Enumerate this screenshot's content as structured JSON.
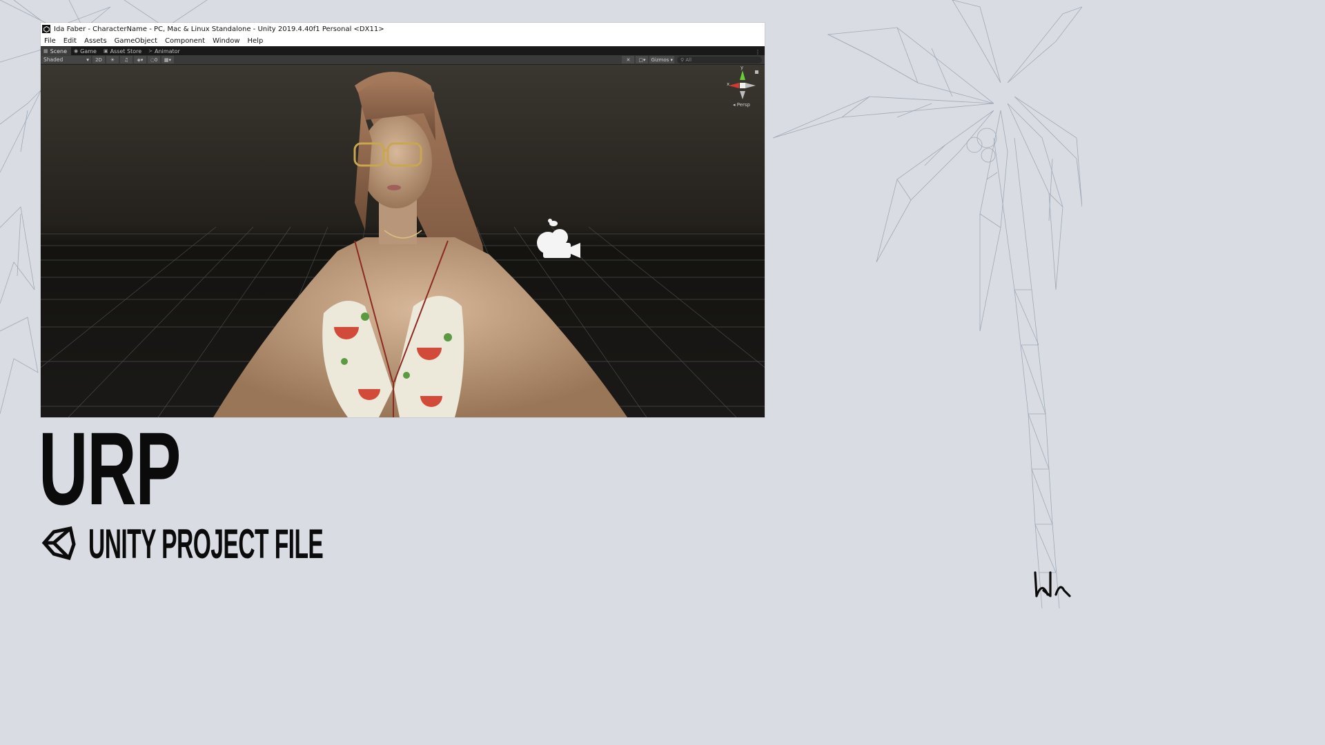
{
  "window": {
    "title": "Ida Faber - CharacterName - PC, Mac & Linux Standalone - Unity 2019.4.40f1 Personal <DX11>",
    "menu": [
      "File",
      "Edit",
      "Assets",
      "GameObject",
      "Component",
      "Window",
      "Help"
    ]
  },
  "editor_tabs": [
    {
      "label": "Scene",
      "icon": "grid-icon",
      "active": true
    },
    {
      "label": "Game",
      "icon": "gamepad-icon",
      "active": false
    },
    {
      "label": "Asset Store",
      "icon": "bag-icon",
      "active": false
    },
    {
      "label": "Animator",
      "icon": "animator-icon",
      "active": false
    }
  ],
  "scene_toolbar": {
    "shading_mode": "Shaded",
    "mode_2d": "2D",
    "hidden_count": "0",
    "gizmos_label": "Gizmos",
    "search_placeholder": "All"
  },
  "scene_gizmo": {
    "y_label": "y",
    "x_label": "x",
    "projection_label": "Persp"
  },
  "slide": {
    "title": "URP",
    "subtitle": "UNITY PROJECT FILE"
  },
  "colors": {
    "background": "#d9dde3",
    "text": "#0b0b0b",
    "unity_dark_tab": "#191919",
    "viewport_sky": "#1c1a16",
    "gizmo_y": "#6ccb3a",
    "gizmo_x": "#d23a2f"
  }
}
